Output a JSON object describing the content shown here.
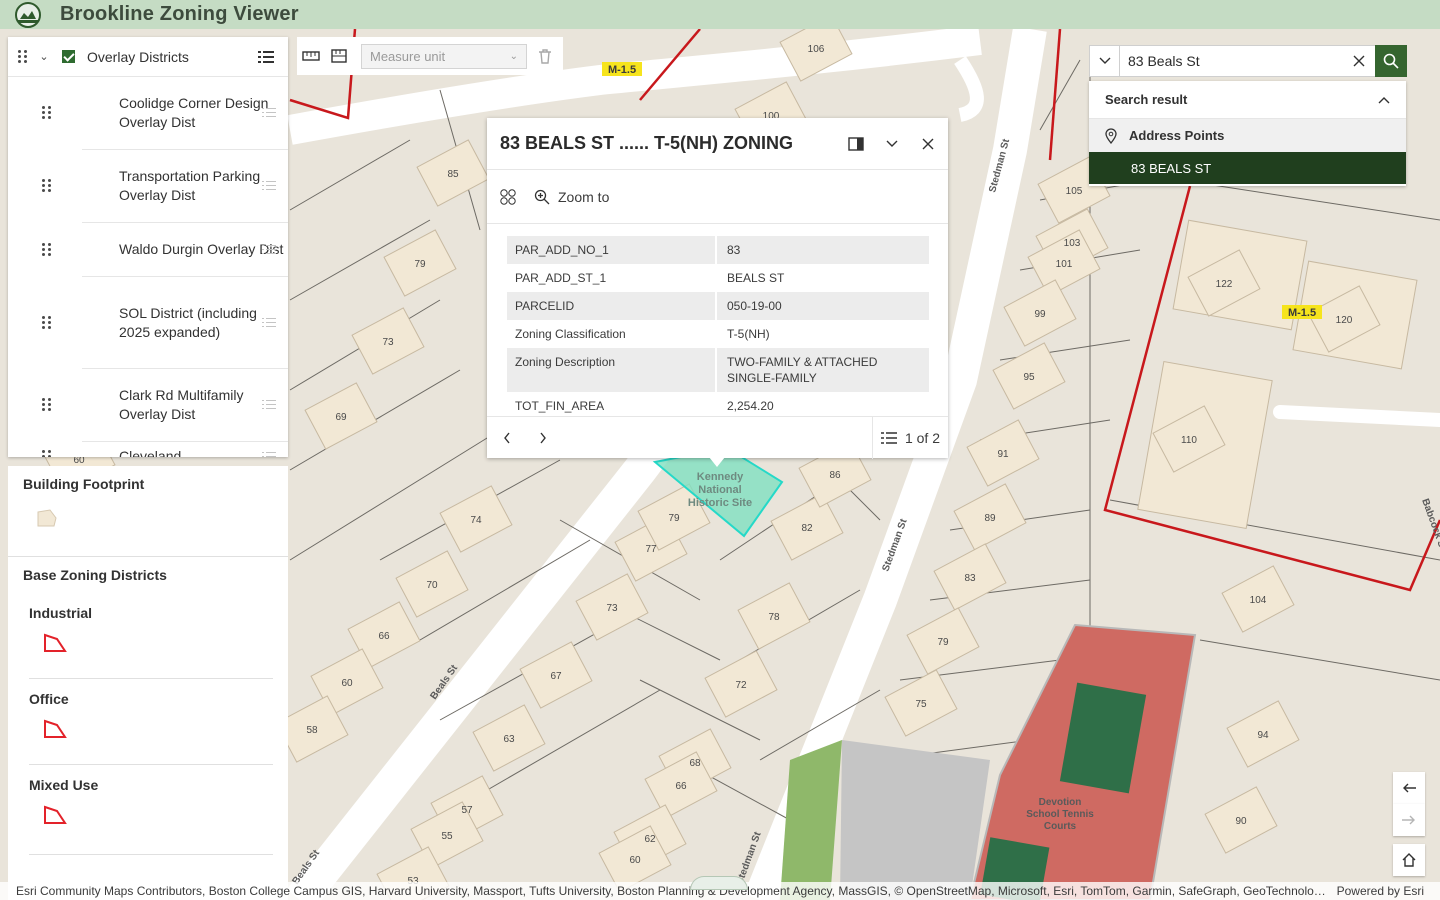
{
  "app": {
    "title": "Brookline Zoning Viewer"
  },
  "layers": {
    "group_title": "Overlay Districts",
    "items": [
      {
        "label": "Coolidge Corner Design Overlay Dist"
      },
      {
        "label": "Transportation Parking Overlay Dist"
      },
      {
        "label": "Waldo Durgin Overlay Dist"
      },
      {
        "label": "SOL District (including 2025 expanded)"
      },
      {
        "label": "Clark Rd Multifamily Overlay Dist"
      },
      {
        "label": "Cleveland"
      }
    ]
  },
  "legend": {
    "building_footprint": "Building Footprint",
    "base_zoning": "Base Zoning Districts",
    "classes": [
      "Industrial",
      "Office",
      "Mixed Use"
    ]
  },
  "measure": {
    "unit_placeholder": "Measure unit"
  },
  "popup": {
    "title": "83 BEALS ST ...... T-5(NH) ZONING",
    "zoom_label": "Zoom to",
    "rows": [
      {
        "key": "PAR_ADD_NO_1",
        "value": "83"
      },
      {
        "key": "PAR_ADD_ST_1",
        "value": "BEALS ST"
      },
      {
        "key": "PARCELID",
        "value": "050-19-00"
      },
      {
        "key": "Zoning Classification",
        "value": "T-5(NH)"
      },
      {
        "key": "Zoning Description",
        "value": "TWO-FAMILY & ATTACHED SINGLE-FAMILY"
      },
      {
        "key": "TOT_FIN_AREA",
        "value": "2,254.20"
      }
    ],
    "count": "1 of 2"
  },
  "search": {
    "value": "83 Beals St",
    "results_title": "Search result",
    "group": "Address Points",
    "result": "83 BEALS ST"
  },
  "map": {
    "zone_labels": [
      "M-1.5",
      "M-1.5"
    ],
    "streets": [
      "Beals St",
      "Stedman St",
      "Stedman St",
      "Beals St",
      "Stedman St",
      "Babcock St"
    ],
    "places": [
      "Kennedy National Historic Site",
      "Devotion School Tennis Courts"
    ],
    "house_numbers": [
      "106",
      "100",
      "85",
      "79",
      "73",
      "69",
      "60",
      "74",
      "70",
      "66",
      "60",
      "58",
      "57",
      "55",
      "53",
      "63",
      "67",
      "73",
      "77",
      "79",
      "72",
      "68",
      "66",
      "62",
      "60",
      "78",
      "82",
      "86",
      "105",
      "103",
      "101",
      "99",
      "95",
      "91",
      "89",
      "83",
      "79",
      "75",
      "122",
      "120",
      "110",
      "104",
      "94",
      "90"
    ],
    "colors": {
      "selection": "#25d9c8",
      "district_boundary": "#c8181c",
      "building": "#f2e8d5",
      "tennis_court": "#cf6a62"
    }
  },
  "attribution": {
    "text": "Esri Community Maps Contributors, Boston College Campus GIS, Harvard University, Massport, Tufts University, Boston Planning & Development Agency, MassGIS, © OpenStreetMap, Microsoft, Esri, TomTom, Garmin, SafeGraph, GeoTechnologies, Inc, ...",
    "powered": "Powered by Esri"
  }
}
